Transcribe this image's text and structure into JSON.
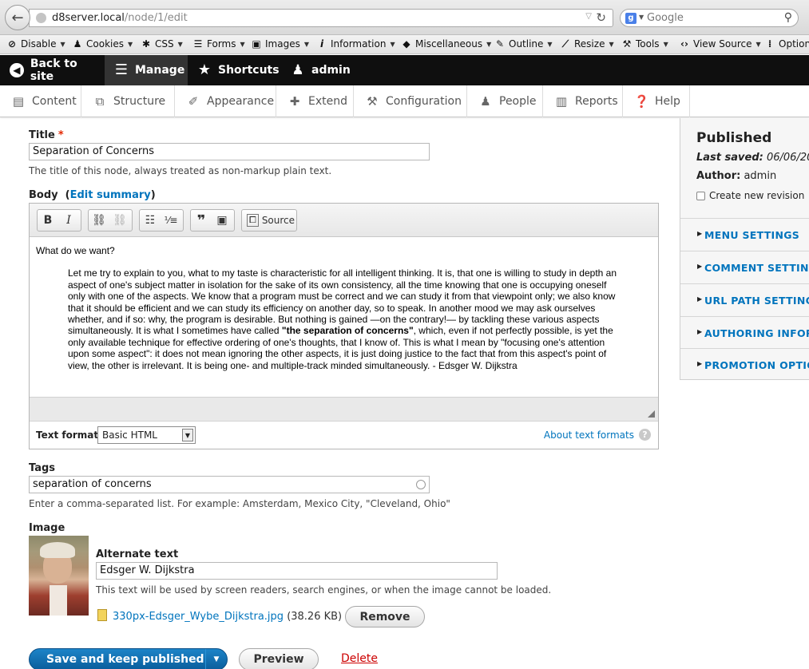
{
  "browser": {
    "url_host": "d8server.local",
    "url_path": "/node/1/edit",
    "search_placeholder": "Google",
    "search_engine_letter": "g"
  },
  "devbar": {
    "items": [
      {
        "label": "Disable",
        "icon": "disable-icon"
      },
      {
        "label": "Cookies",
        "icon": "person-icon"
      },
      {
        "label": "CSS",
        "icon": "wand-icon"
      },
      {
        "label": "Forms",
        "icon": "list-icon"
      },
      {
        "label": "Images",
        "icon": "image-icon"
      },
      {
        "label": "Information",
        "icon": "info-icon"
      },
      {
        "label": "Miscellaneous",
        "icon": "cube-icon"
      },
      {
        "label": "Outline",
        "icon": "pencil-icon"
      },
      {
        "label": "Resize",
        "icon": "ruler-icon"
      },
      {
        "label": "Tools",
        "icon": "wrench-icon"
      },
      {
        "label": "View Source",
        "icon": "code-icon"
      },
      {
        "label": "Options",
        "icon": "options-icon"
      }
    ]
  },
  "toolbar": {
    "back": "Back to site",
    "manage": "Manage",
    "shortcuts": "Shortcuts",
    "user": "admin"
  },
  "tray": {
    "items": [
      "Content",
      "Structure",
      "Appearance",
      "Extend",
      "Configuration",
      "People",
      "Reports",
      "Help"
    ]
  },
  "form": {
    "title_label": "Title",
    "title_required": "*",
    "title_value": "Separation of Concerns",
    "title_desc": "The title of this node, always treated as non-markup plain text.",
    "body_label": "Body",
    "body_edit_summary": "Edit summary",
    "editor": {
      "source_label": "Source",
      "paragraph": "What do we want?",
      "quote_before": "Let me try to explain to you, what to my taste is characteristic for all intelligent thinking. It is, that one is willing to study in depth an aspect of one's subject matter in isolation for the sake of its own consistency, all the time knowing that one is occupying oneself only with one of the aspects. We know that a program must be correct and we can study it from that viewpoint only; we also know that it should be efficient and we can study its efficiency on another day, so to speak. In another mood we may ask ourselves whether, and if so: why, the program is desirable. But nothing is gained —on the contrary!— by tackling these various aspects simultaneously. It is what I sometimes have called ",
      "quote_bold": "\"the separation of concerns\"",
      "quote_after": ", which, even if not perfectly possible, is yet the only available technique for effective ordering of one's thoughts, that I know of. This is what I mean by \"focusing one's attention upon some aspect\": it does not mean ignoring the other aspects, it is just doing justice to the fact that from this aspect's point of view, the other is irrelevant. It is being one- and multiple-track minded simultaneously. - Edsger W. Dijkstra",
      "text_format_label": "Text format",
      "text_format_value": "Basic HTML",
      "about_text_formats": "About text formats"
    },
    "tags_label": "Tags",
    "tags_value": "separation of concerns",
    "tags_desc": "Enter a comma-separated list. For example: Amsterdam, Mexico City, \"Cleveland, Ohio\"",
    "image_label": "Image",
    "alt_label": "Alternate text",
    "alt_value": "Edsger W. Dijkstra",
    "alt_desc": "This text will be used by screen readers, search engines, or when the image cannot be loaded.",
    "file_name": "330px-Edsger_Wybe_Dijkstra.jpg",
    "file_size": "(38.26 KB)",
    "remove_label": "Remove"
  },
  "actions": {
    "save": "Save and keep published",
    "preview": "Preview",
    "delete": "Delete"
  },
  "sidebar": {
    "status": "Published",
    "last_saved_label": "Last saved:",
    "last_saved_value": "06/06/20",
    "author_label": "Author:",
    "author_value": "admin",
    "create_revision": "Create new revision",
    "sections": [
      "MENU SETTINGS",
      "COMMENT SETTING",
      "URL PATH SETTINGS",
      "AUTHORING INFORM",
      "PROMOTION OPTIO"
    ]
  },
  "colors": {
    "link": "#0074bd",
    "toolbar_bg": "#0f0f0f",
    "primary_button": "#0a6fb8",
    "required": "#e32700",
    "delete": "#cc0000"
  }
}
